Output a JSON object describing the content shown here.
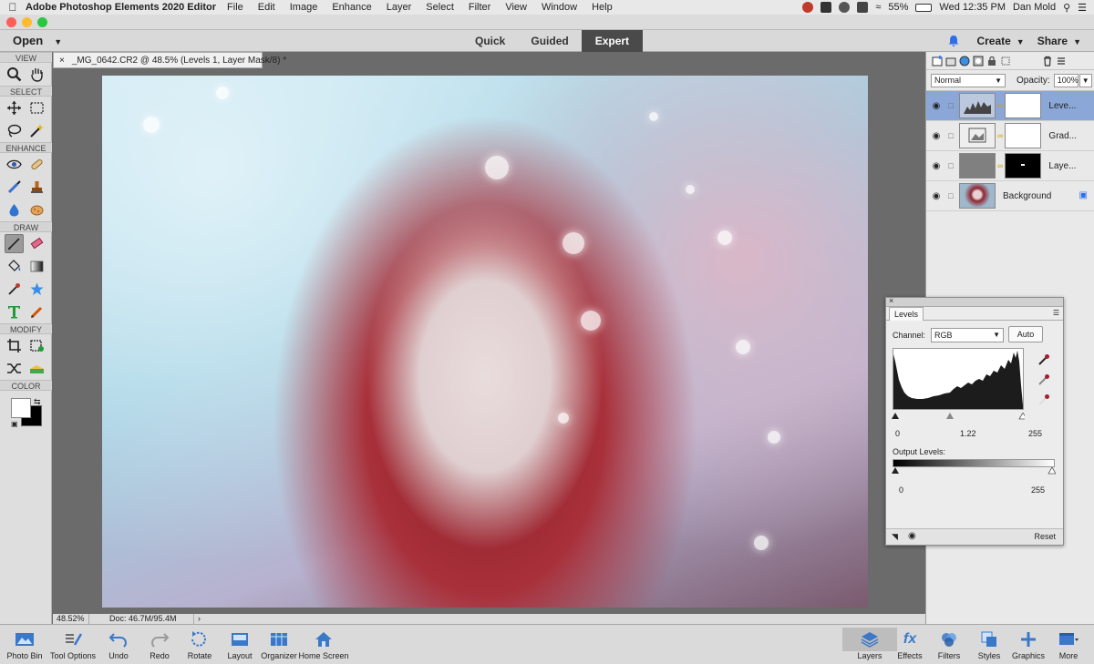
{
  "menubar": {
    "app_name": "Adobe Photoshop Elements 2020 Editor",
    "items": [
      "File",
      "Edit",
      "Image",
      "Enhance",
      "Layer",
      "Select",
      "Filter",
      "View",
      "Window",
      "Help"
    ],
    "battery": "55%",
    "clock": "Wed 12:35 PM",
    "user": "Dan Mold"
  },
  "topbar": {
    "open_label": "Open",
    "modes": [
      "Quick",
      "Guided",
      "Expert"
    ],
    "active_mode": "Expert",
    "create_label": "Create",
    "share_label": "Share"
  },
  "toolbox": {
    "sections": [
      "VIEW",
      "SELECT",
      "ENHANCE",
      "DRAW",
      "MODIFY",
      "COLOR"
    ]
  },
  "document": {
    "tab_title": "_MG_0642.CR2 @ 48.5% (Levels 1, Layer Mask/8) *",
    "zoom": "48.52%",
    "doc_size": "Doc: 46.7M/95.4M"
  },
  "layers_panel": {
    "blend_mode": "Normal",
    "opacity_label": "Opacity:",
    "opacity_value": "100%",
    "layers": [
      {
        "name": "Leve...",
        "active": true
      },
      {
        "name": "Grad...",
        "active": false
      },
      {
        "name": "Laye...",
        "active": false
      },
      {
        "name": "Background",
        "active": false
      }
    ]
  },
  "levels": {
    "tab": "Levels",
    "channel_label": "Channel:",
    "channel_value": "RGB",
    "auto_label": "Auto",
    "input_black": "0",
    "input_gamma": "1.22",
    "input_white": "255",
    "output_label": "Output Levels:",
    "output_black": "0",
    "output_white": "255",
    "reset_label": "Reset"
  },
  "bottombar": {
    "left": [
      "Photo Bin",
      "Tool Options",
      "Undo",
      "Redo",
      "Rotate",
      "Layout",
      "Organizer",
      "Home Screen"
    ],
    "right": [
      "Layers",
      "Effects",
      "Filters",
      "Styles",
      "Graphics",
      "More"
    ]
  },
  "colors": {
    "accent_blue": "#2e6fe8",
    "active_layer": "#8aa7d8",
    "mode_active": "#4a4a4a"
  }
}
